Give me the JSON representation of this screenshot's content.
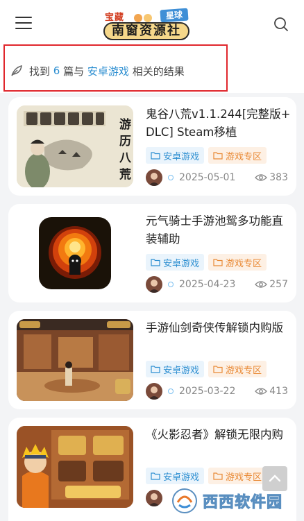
{
  "header": {
    "logo": {
      "small_text": "宝藏",
      "badge_text": "星球",
      "main_text": "南窗资源社"
    }
  },
  "search_result": {
    "prefix": "找到",
    "count": "6",
    "middle": "篇与",
    "keyword": "安卓游戏",
    "suffix": "相关的结果"
  },
  "articles": [
    {
      "title": "鬼谷八荒v1.1.244[完整版+ DLC] Steam移植",
      "tag1": "安卓游戏",
      "tag2": "游戏专区",
      "date": "2025-05-01",
      "views": "383"
    },
    {
      "title": "元气骑士手游池鸳多功能直装辅助",
      "tag1": "安卓游戏",
      "tag2": "游戏专区",
      "date": "2025-04-23",
      "views": "257"
    },
    {
      "title": "手游仙剑奇侠传解锁内购版",
      "tag1": "安卓游戏",
      "tag2": "游戏专区",
      "date": "2025-03-22",
      "views": "413"
    },
    {
      "title": "《火影忍者》解锁无限内购",
      "tag1": "安卓游戏",
      "tag2": "游戏专区",
      "date": "",
      "views": ""
    }
  ],
  "thumb_text": {
    "calligraphy": "游历八荒"
  },
  "watermark": {
    "text": "西西软件园"
  },
  "colors": {
    "accent": "#2e8fd1",
    "tag_orange": "#e98a36",
    "highlight_box": "#e0262c"
  }
}
